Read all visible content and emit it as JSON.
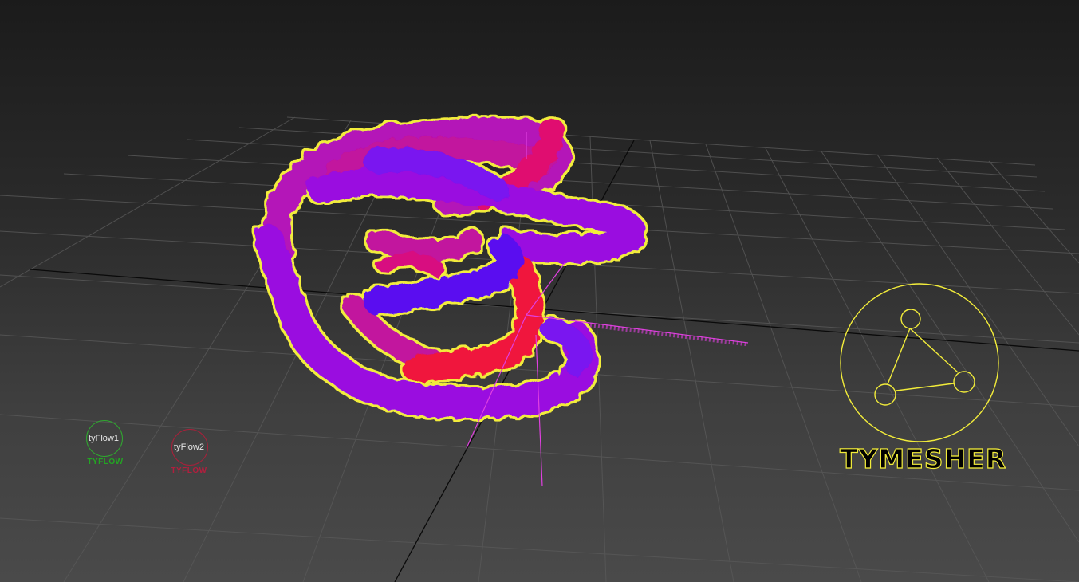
{
  "viewport": {
    "background_top": "#1b1b1b",
    "background_bottom": "#4a4a4a",
    "grid_color": "#5a5a5a",
    "axis_color": "#0a0a0a",
    "selection_outline_color": "#f2ec3a",
    "gizmo_color": "#e040e0"
  },
  "mesh": {
    "colors": {
      "purple": "#9a10e0",
      "magenta": "#c2129e",
      "red": "#f0133e",
      "blue": "#5a10f0"
    }
  },
  "emitters": [
    {
      "name": "tyFlow1",
      "logo": "TYFLOW",
      "color": "#2fa82f"
    },
    {
      "name": "tyFlow2",
      "logo": "TYFLOW",
      "color": "#b01f3e"
    }
  ],
  "tymesher": {
    "label": "TYMESHER",
    "icon": "tymesher-triangle-icon",
    "color": "#f2ec3a"
  }
}
